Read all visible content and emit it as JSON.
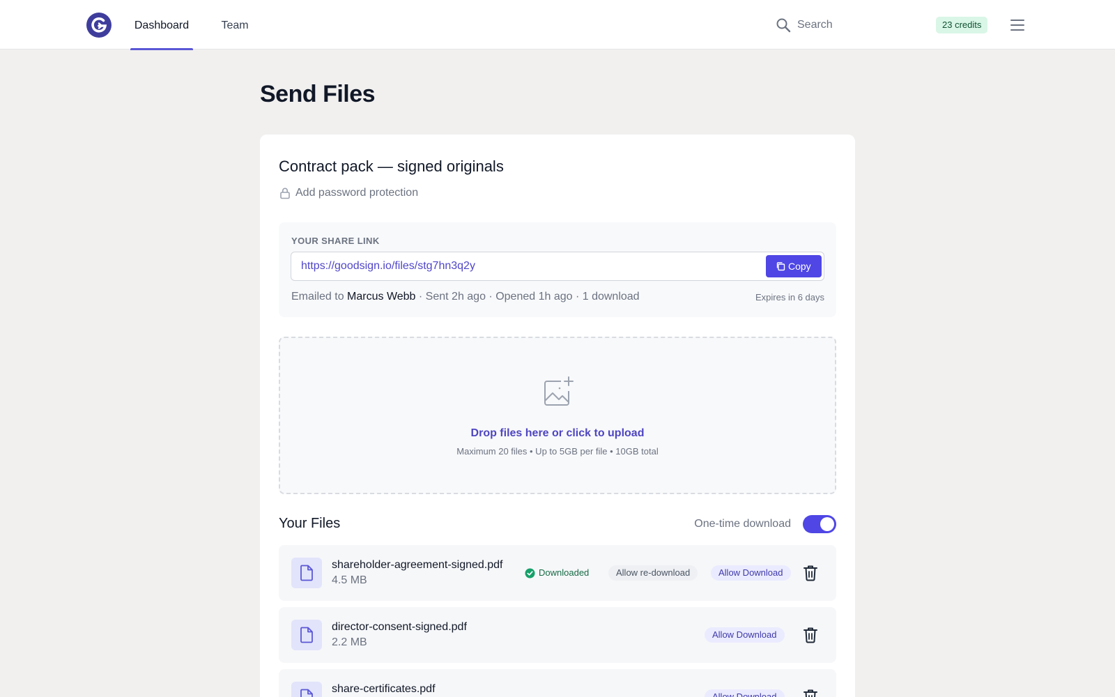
{
  "nav": {
    "tabs": [
      {
        "label": "Dashboard",
        "active": true
      },
      {
        "label": "Team",
        "active": false
      }
    ],
    "search_placeholder": "Search",
    "credits": "23 credits"
  },
  "page": {
    "title": "Send Files"
  },
  "transfer": {
    "title": "Contract pack — signed originals",
    "password_link": "Add password protection",
    "share": {
      "label": "YOUR SHARE LINK",
      "url": "https://goodsign.io/files/stg7hn3q2y",
      "copy_label": "Copy",
      "emailed_prefix": "Emailed to",
      "recipient": "Marcus Webb",
      "meta_suffix": "· Sent 2h ago · Opened 1h ago · 1 download",
      "expires": "Expires in 6 days"
    },
    "dropzone": {
      "title": "Drop files here or click to upload",
      "subtitle": "Maximum 20 files • Up to 5GB per file • 10GB total"
    },
    "files_heading": "Your Files",
    "one_time_download": {
      "label": "One-time download",
      "enabled": true
    },
    "files": [
      {
        "name": "shareholder-agreement-signed.pdf",
        "size": "4.5 MB",
        "status": "Downloaded",
        "redownload_label": "Allow re-download",
        "allow_label": "Allow Download"
      },
      {
        "name": "director-consent-signed.pdf",
        "size": "2.2 MB",
        "allow_label": "Allow Download"
      },
      {
        "name": "share-certificates.pdf",
        "size": "",
        "allow_label": "Allow Download"
      }
    ]
  },
  "colors": {
    "accent": "#4f46e5",
    "brand": "#3f3d9c",
    "success": "#166a45",
    "credits_bg": "#d9f6e6",
    "page_bg": "#f1f0ef"
  },
  "icons": [
    "brand-logo-icon",
    "search-icon",
    "menu-icon",
    "lock-icon",
    "copy-icon",
    "image-upload-icon",
    "file-icon",
    "check-circle-icon",
    "trash-icon"
  ]
}
